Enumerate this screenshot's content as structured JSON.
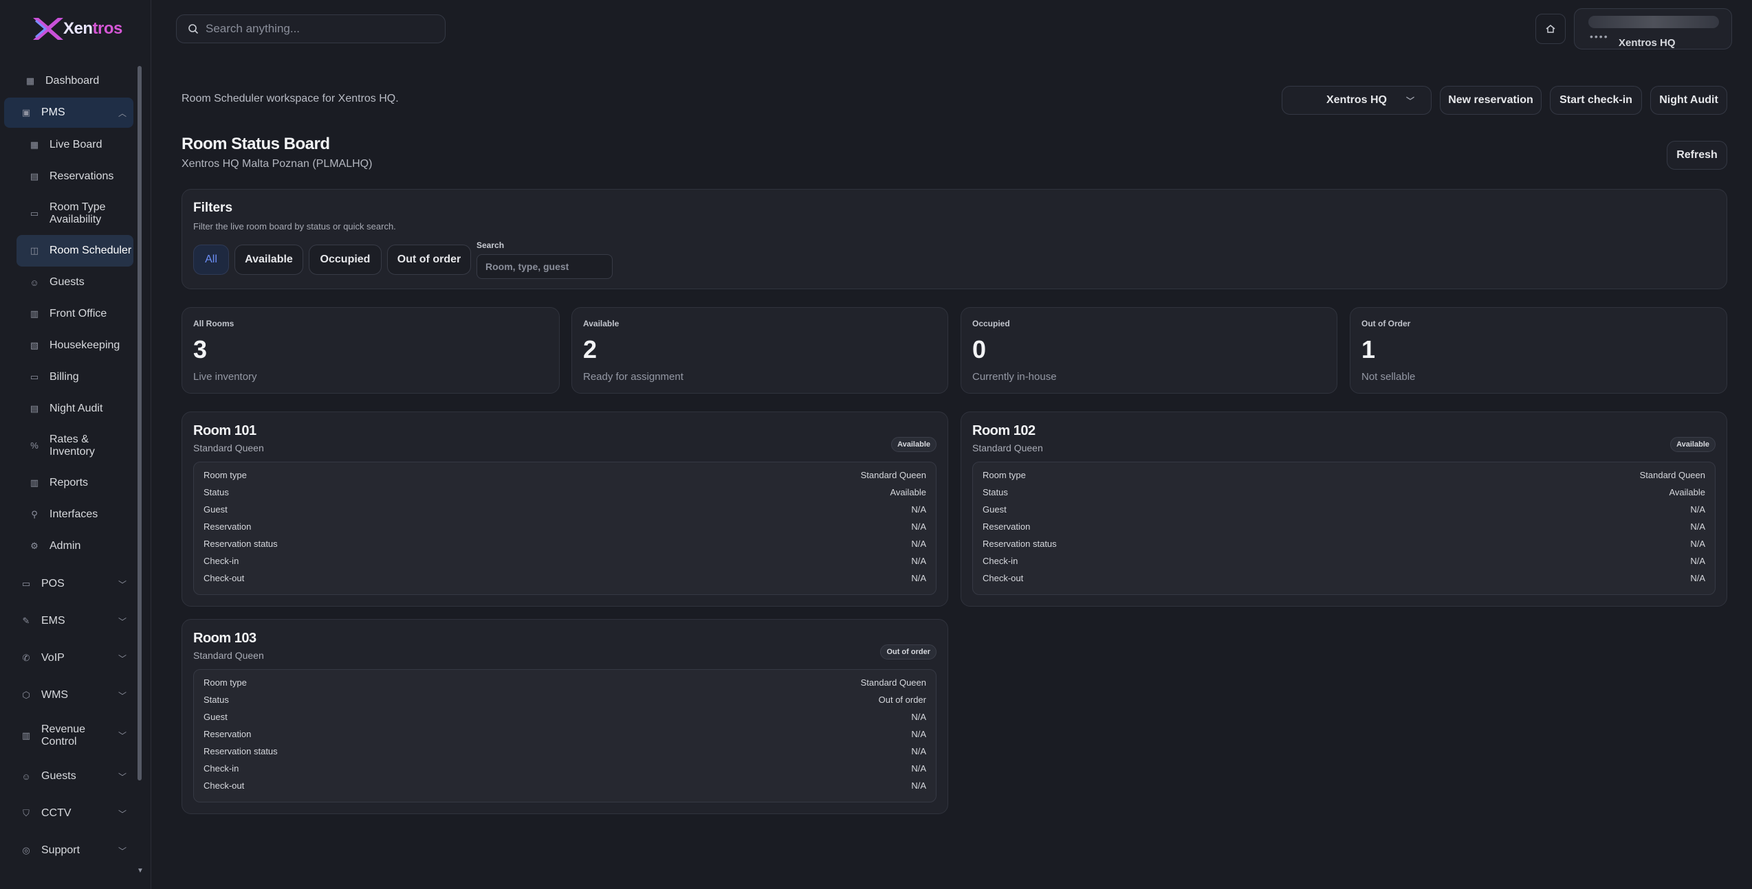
{
  "brand": {
    "name_main": "Xen",
    "name_accent": "tros"
  },
  "search": {
    "placeholder": "Search anything..."
  },
  "profile": {
    "org": "Xentros HQ",
    "dots": "••••"
  },
  "sidebar": {
    "dashboard": "Dashboard",
    "pms": "PMS",
    "pms_items": [
      "Live Board",
      "Reservations",
      "Room Type Availability",
      "Room Scheduler",
      "Guests",
      "Front Office",
      "Housekeeping",
      "Billing",
      "Night Audit",
      "Rates & Inventory",
      "Reports",
      "Interfaces",
      "Admin"
    ],
    "groups": [
      "POS",
      "EMS",
      "VoIP",
      "WMS",
      "Revenue Control",
      "Guests",
      "CCTV",
      "Support"
    ]
  },
  "header": {
    "workspace": "Room Scheduler workspace for Xentros HQ.",
    "property_select": "Xentros HQ",
    "new_reservation": "New reservation",
    "start_checkin": "Start check-in",
    "night_audit": "Night Audit",
    "title": "Room Status Board",
    "subtitle": "Xentros HQ Malta Poznan (PLMALHQ)",
    "refresh": "Refresh"
  },
  "filters": {
    "title": "Filters",
    "subtitle": "Filter the live room board by status or quick search.",
    "pills": [
      "All",
      "Available",
      "Occupied",
      "Out of order"
    ],
    "search_label": "Search",
    "search_placeholder": "Room, type, guest"
  },
  "stats": [
    {
      "label": "All Rooms",
      "value": "3",
      "note": "Live inventory"
    },
    {
      "label": "Available",
      "value": "2",
      "note": "Ready for assignment"
    },
    {
      "label": "Occupied",
      "value": "0",
      "note": "Currently in-house"
    },
    {
      "label": "Out of Order",
      "value": "1",
      "note": "Not sellable"
    }
  ],
  "detail_labels": [
    "Room type",
    "Status",
    "Guest",
    "Reservation",
    "Reservation status",
    "Check-in",
    "Check-out"
  ],
  "rooms": [
    {
      "name": "Room 101",
      "type": "Standard Queen",
      "badge": "Available",
      "values": [
        "Standard Queen",
        "Available",
        "N/A",
        "N/A",
        "N/A",
        "N/A",
        "N/A"
      ]
    },
    {
      "name": "Room 102",
      "type": "Standard Queen",
      "badge": "Available",
      "values": [
        "Standard Queen",
        "Available",
        "N/A",
        "N/A",
        "N/A",
        "N/A",
        "N/A"
      ]
    },
    {
      "name": "Room 103",
      "type": "Standard Queen",
      "badge": "Out of order",
      "values": [
        "Standard Queen",
        "Out of order",
        "N/A",
        "N/A",
        "N/A",
        "N/A",
        "N/A"
      ]
    }
  ]
}
